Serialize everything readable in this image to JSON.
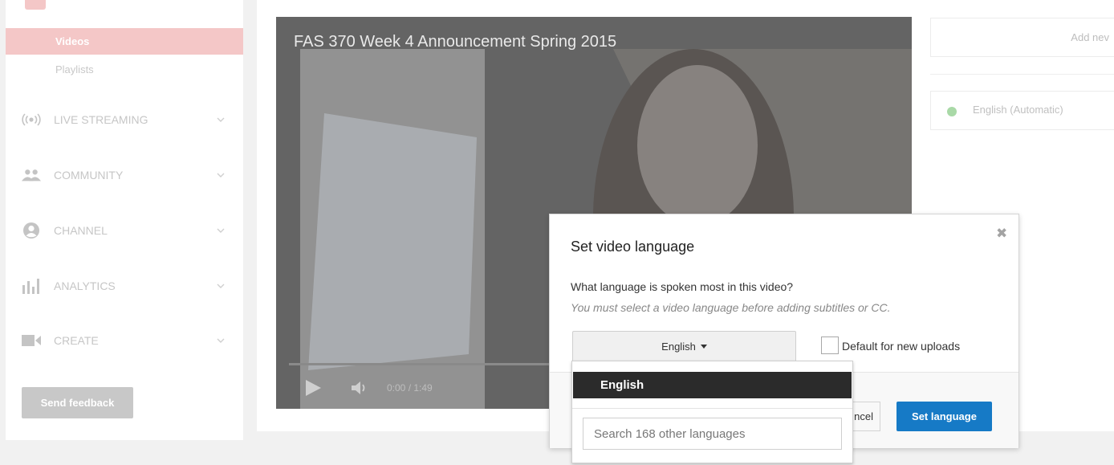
{
  "sidebar": {
    "videos_label": "Videos",
    "playlists_label": "Playlists",
    "sections": [
      {
        "label": "LIVE STREAMING",
        "icon": "live-streaming-icon"
      },
      {
        "label": "COMMUNITY",
        "icon": "community-icon"
      },
      {
        "label": "CHANNEL",
        "icon": "channel-icon"
      },
      {
        "label": "ANALYTICS",
        "icon": "analytics-icon"
      },
      {
        "label": "CREATE",
        "icon": "create-icon"
      }
    ],
    "feedback_label": "Send feedback"
  },
  "video": {
    "title": "FAS 370 Week 4 Announcement Spring 2015",
    "time": "0:00 / 1:49"
  },
  "right_panel": {
    "add_new_label": "Add nev",
    "language_entry": "English (Automatic)"
  },
  "dialog": {
    "title": "Set video language",
    "question": "What language is spoken most in this video?",
    "hint": "You must select a video language before adding subtitles or CC.",
    "select_value": "English",
    "checkbox_label": "Default for new uploads",
    "cancel_label": "ncel",
    "set_label": "Set language",
    "primary_color": "#167ac6"
  },
  "dropdown": {
    "selected": "English",
    "search_placeholder": "Search 168 other languages"
  }
}
